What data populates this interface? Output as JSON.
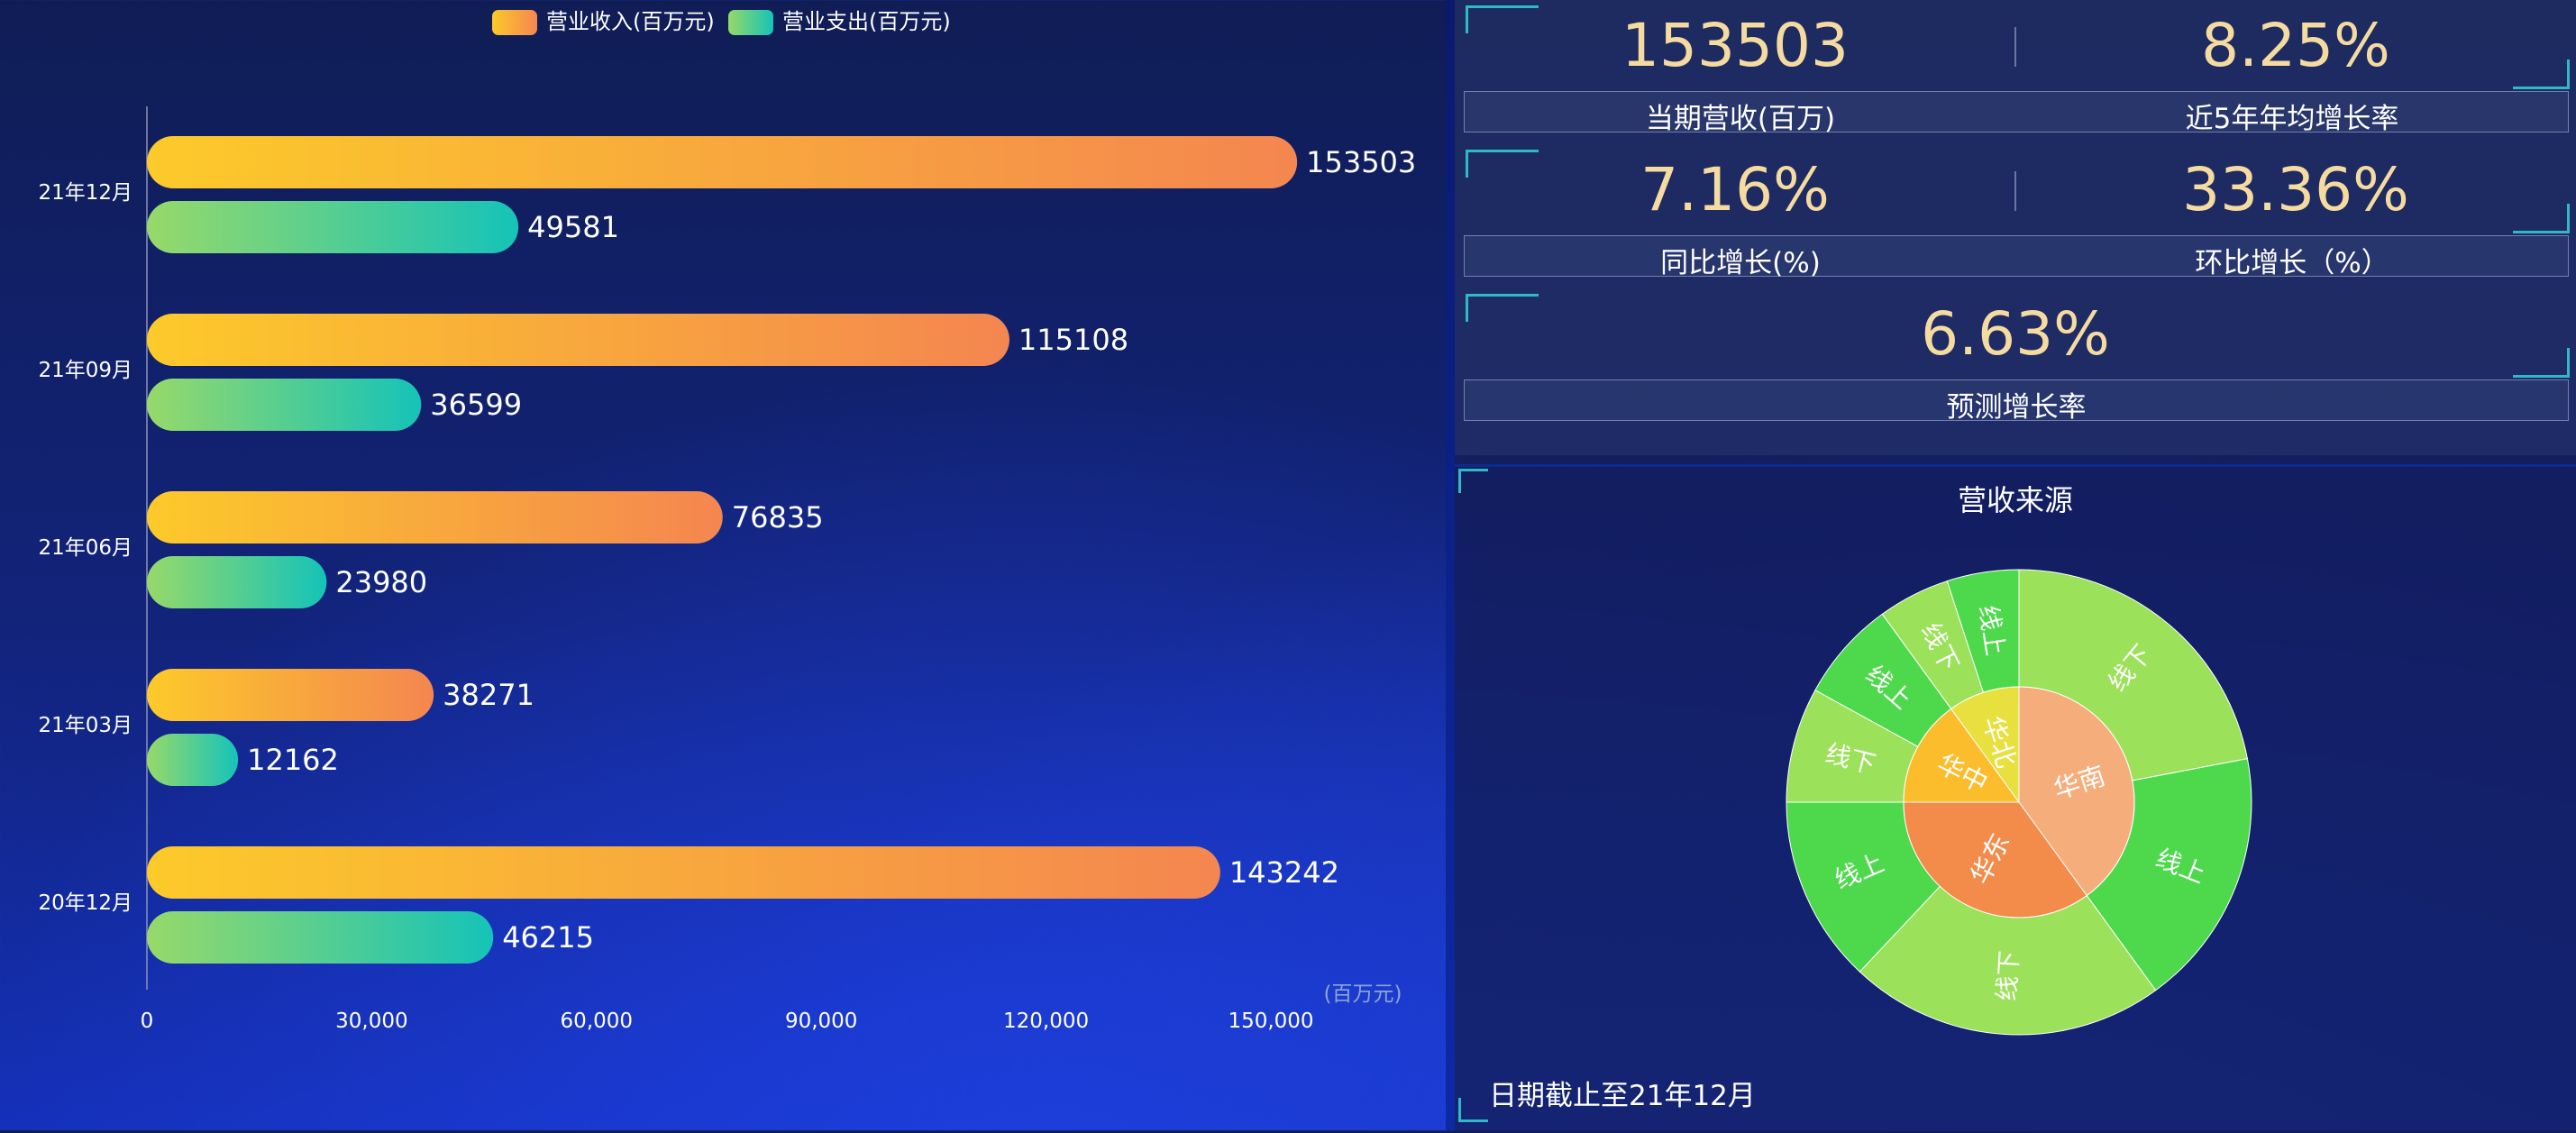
{
  "legend": {
    "income": "营业收入(百万元)",
    "expense": "营业支出(百万元)"
  },
  "chart_data": [
    {
      "type": "bar",
      "orientation": "horizontal",
      "categories": [
        "21年12月",
        "21年09月",
        "21年06月",
        "21年03月",
        "20年12月"
      ],
      "series": [
        {
          "name": "营业收入(百万元)",
          "values": [
            153503,
            115108,
            76835,
            38271,
            143242
          ],
          "color_start": "#fcca2a",
          "color_end": "#f48650"
        },
        {
          "name": "营业支出(百万元)",
          "values": [
            49581,
            36599,
            23980,
            12162,
            46215
          ],
          "color_start": "#97d96a",
          "color_end": "#15c3b8"
        }
      ],
      "x_ticks": [
        "0",
        "30,000",
        "60,000",
        "90,000",
        "120,000",
        "150,000"
      ],
      "xlim": [
        0,
        150000
      ],
      "unit_label": "(百万元)",
      "grid": false
    },
    {
      "type": "pie",
      "subtype": "sunburst",
      "title": "营收来源",
      "inner": [
        {
          "label": "华南",
          "value": 4,
          "color": "#f5ae7b"
        },
        {
          "label": "华东",
          "value": 3.5,
          "color": "#f38c4a"
        },
        {
          "label": "华中",
          "value": 1.5,
          "color": "#fbbd2c"
        },
        {
          "label": "华北",
          "value": 1,
          "color": "#e8e03e"
        }
      ],
      "outer": [
        {
          "label": "线下",
          "value": 2.2,
          "color": "#9be15a"
        },
        {
          "label": "线上",
          "value": 1.8,
          "color": "#4ed94c"
        },
        {
          "label": "线下",
          "value": 2.2,
          "color": "#9be15a"
        },
        {
          "label": "线上",
          "value": 1.3,
          "color": "#4ed94c"
        },
        {
          "label": "线下",
          "value": 0.8,
          "color": "#9be15a"
        },
        {
          "label": "线上",
          "value": 0.7,
          "color": "#4ed94c"
        },
        {
          "label": "线下",
          "value": 0.5,
          "color": "#9be15a"
        },
        {
          "label": "线上",
          "value": 0.5,
          "color": "#4ed94c"
        }
      ]
    }
  ],
  "stats": {
    "current_revenue": {
      "value": "153503",
      "label": "当期营收(百万)"
    },
    "avg_growth_5y": {
      "value": "8.25%",
      "label": "近5年年均增长率"
    },
    "yoy_growth": {
      "value": "7.16%",
      "label": "同比增长(%)"
    },
    "mom_growth": {
      "value": "33.36%",
      "label": "环比增长（%）"
    },
    "forecast_growth": {
      "value": "6.63%",
      "label": "预测增长率"
    }
  },
  "date_note": "日期截止至21年12月"
}
